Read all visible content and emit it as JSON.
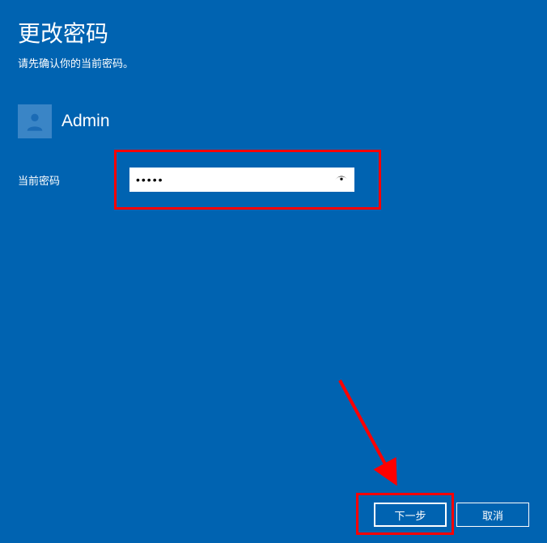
{
  "title": "更改密码",
  "subtitle": "请先确认你的当前密码。",
  "username": "Admin",
  "field": {
    "label": "当前密码",
    "value": "•••••"
  },
  "buttons": {
    "next": "下一步",
    "cancel": "取消"
  }
}
